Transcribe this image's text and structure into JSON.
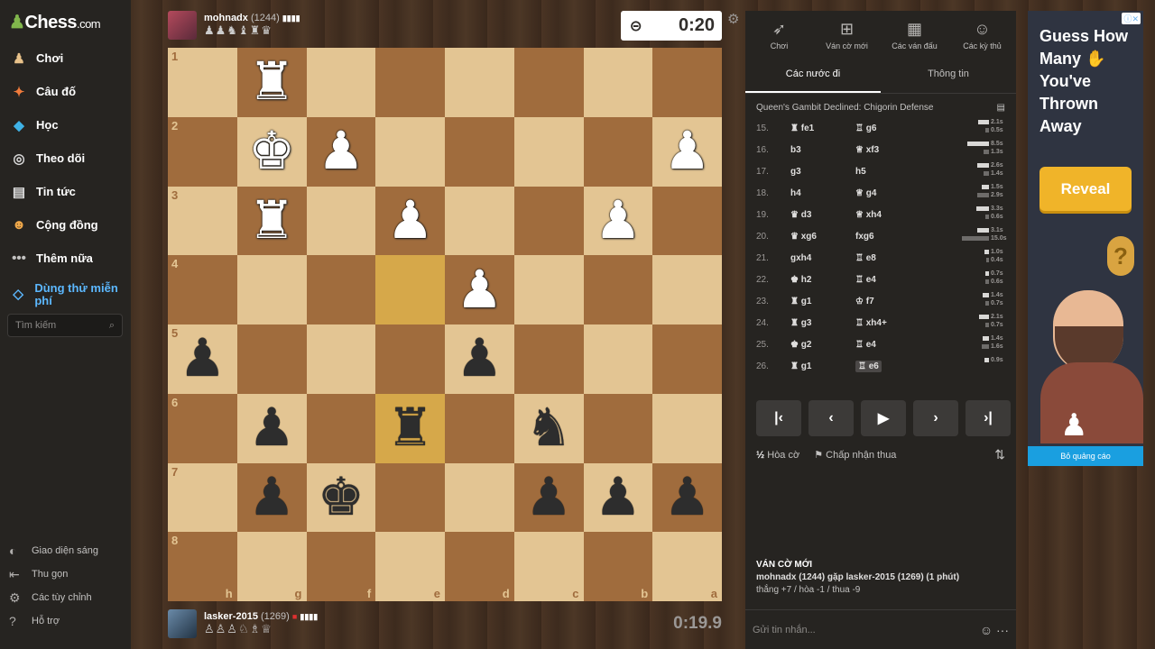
{
  "sidebar": {
    "logo_main": "Chess",
    "logo_suffix": ".com",
    "items": [
      {
        "label": "Chơi",
        "icon": "pawn-icon"
      },
      {
        "label": "Câu đố",
        "icon": "puzzle-icon"
      },
      {
        "label": "Học",
        "icon": "learn-icon"
      },
      {
        "label": "Theo dõi",
        "icon": "binoculars-icon"
      },
      {
        "label": "Tin tức",
        "icon": "news-icon"
      },
      {
        "label": "Cộng đồng",
        "icon": "community-icon"
      },
      {
        "label": "Thêm nữa",
        "icon": "more-icon"
      },
      {
        "label": "Dùng thử miễn phí",
        "icon": "diamond-icon"
      }
    ],
    "search_placeholder": "Tìm kiếm",
    "footer": [
      {
        "label": "Giao diện sáng",
        "icon": "theme-icon"
      },
      {
        "label": "Thu gọn",
        "icon": "collapse-icon"
      },
      {
        "label": "Các tùy chỉnh",
        "icon": "settings-icon"
      },
      {
        "label": "Hỗ trợ",
        "icon": "help-icon"
      }
    ]
  },
  "top_player": {
    "name": "mohnadx",
    "rating": "(1244)",
    "captured": "♟♟♞♝♜♛",
    "clock": "0:20"
  },
  "bottom_player": {
    "name": "lasker-2015",
    "rating": "(1269)",
    "captured": "♙♙♙♘♗♕",
    "clock": "0:19.9"
  },
  "board": {
    "ranks": [
      "1",
      "2",
      "3",
      "4",
      "5",
      "6",
      "7",
      "8"
    ],
    "files": [
      "h",
      "g",
      "f",
      "e",
      "d",
      "c",
      "b",
      "a"
    ],
    "pieces": [
      [
        "",
        "♜w",
        "",
        "",
        "",
        "",
        "",
        ""
      ],
      [
        "",
        "♚w",
        "♟w",
        "",
        "",
        "",
        "",
        "♟w"
      ],
      [
        "",
        "♜w",
        "",
        "♟w",
        "",
        "",
        "♟w",
        ""
      ],
      [
        "",
        "",
        "",
        "",
        "♟w",
        "",
        "",
        ""
      ],
      [
        "♟b",
        "",
        "",
        "",
        "♟b",
        "",
        "",
        ""
      ],
      [
        "",
        "♟b",
        "",
        "♜b",
        "",
        "♞b",
        "",
        ""
      ],
      [
        "",
        "♟b",
        "♚b",
        "",
        "",
        "♟b",
        "♟b",
        "♟b"
      ],
      [
        "",
        "",
        "",
        "",
        "",
        "",
        "",
        ""
      ]
    ]
  },
  "panel": {
    "tabs": [
      {
        "label": "Chơi",
        "icon": "rocket-icon"
      },
      {
        "label": "Ván cờ mới",
        "icon": "plus-icon"
      },
      {
        "label": "Các ván đấu",
        "icon": "board-icon"
      },
      {
        "label": "Các kỳ thủ",
        "icon": "players-icon"
      }
    ],
    "subtabs": [
      "Các nước đi",
      "Thông tin"
    ],
    "opening": "Queen's Gambit Declined: Chigorin Defense",
    "moves": [
      {
        "no": "15.",
        "w": "♜ fe1",
        "b": "♖ g6",
        "tw": "2.1s",
        "tb": "0.5s",
        "ww": 12,
        "wb": 4
      },
      {
        "no": "16.",
        "w": "b3",
        "b": "♕ xf3",
        "tw": "8.5s",
        "tb": "1.3s",
        "ww": 24,
        "wb": 6
      },
      {
        "no": "17.",
        "w": "g3",
        "b": "h5",
        "tw": "2.6s",
        "tb": "1.4s",
        "ww": 13,
        "wb": 6
      },
      {
        "no": "18.",
        "w": "h4",
        "b": "♕ g4",
        "tw": "1.5s",
        "tb": "2.9s",
        "ww": 8,
        "wb": 13
      },
      {
        "no": "19.",
        "w": "♛ d3",
        "b": "♕ xh4",
        "tw": "3.3s",
        "tb": "0.6s",
        "ww": 14,
        "wb": 4
      },
      {
        "no": "20.",
        "w": "♛ xg6",
        "b": "fxg6",
        "tw": "3.1s",
        "tb": "15.0s",
        "ww": 13,
        "wb": 30
      },
      {
        "no": "21.",
        "w": "gxh4",
        "b": "♖ e8",
        "tw": "1.0s",
        "tb": "0.4s",
        "ww": 5,
        "wb": 3
      },
      {
        "no": "22.",
        "w": "♚ h2",
        "b": "♖ e4",
        "tw": "0.7s",
        "tb": "0.6s",
        "ww": 4,
        "wb": 4
      },
      {
        "no": "23.",
        "w": "♜ g1",
        "b": "♔ f7",
        "tw": "1.4s",
        "tb": "0.7s",
        "ww": 7,
        "wb": 4
      },
      {
        "no": "24.",
        "w": "♜ g3",
        "b": "♖ xh4+",
        "tw": "2.1s",
        "tb": "0.7s",
        "ww": 11,
        "wb": 4
      },
      {
        "no": "25.",
        "w": "♚ g2",
        "b": "♖ e4",
        "tw": "1.4s",
        "tb": "1.6s",
        "ww": 7,
        "wb": 8
      },
      {
        "no": "26.",
        "w": "♜ g1",
        "b": "♖ e6",
        "tw": "0.9s",
        "tb": "",
        "ww": 5,
        "wb": 0
      }
    ],
    "draw_label": "Hòa cờ",
    "resign_label": "Chấp nhận thua",
    "new_game_title": "VÁN CỜ MỚI",
    "new_game_line1": "mohnadx (1244) gặp lasker-2015 (1269) (1 phút)",
    "new_game_line2": "thắng +7 / hòa -1 / thua -9",
    "chat_placeholder": "Gửi tin nhắn..."
  },
  "ad": {
    "headline": "Guess How Many ✋ You've Thrown Away",
    "button": "Reveal",
    "remove_label": "Bỏ quảng cáo"
  }
}
